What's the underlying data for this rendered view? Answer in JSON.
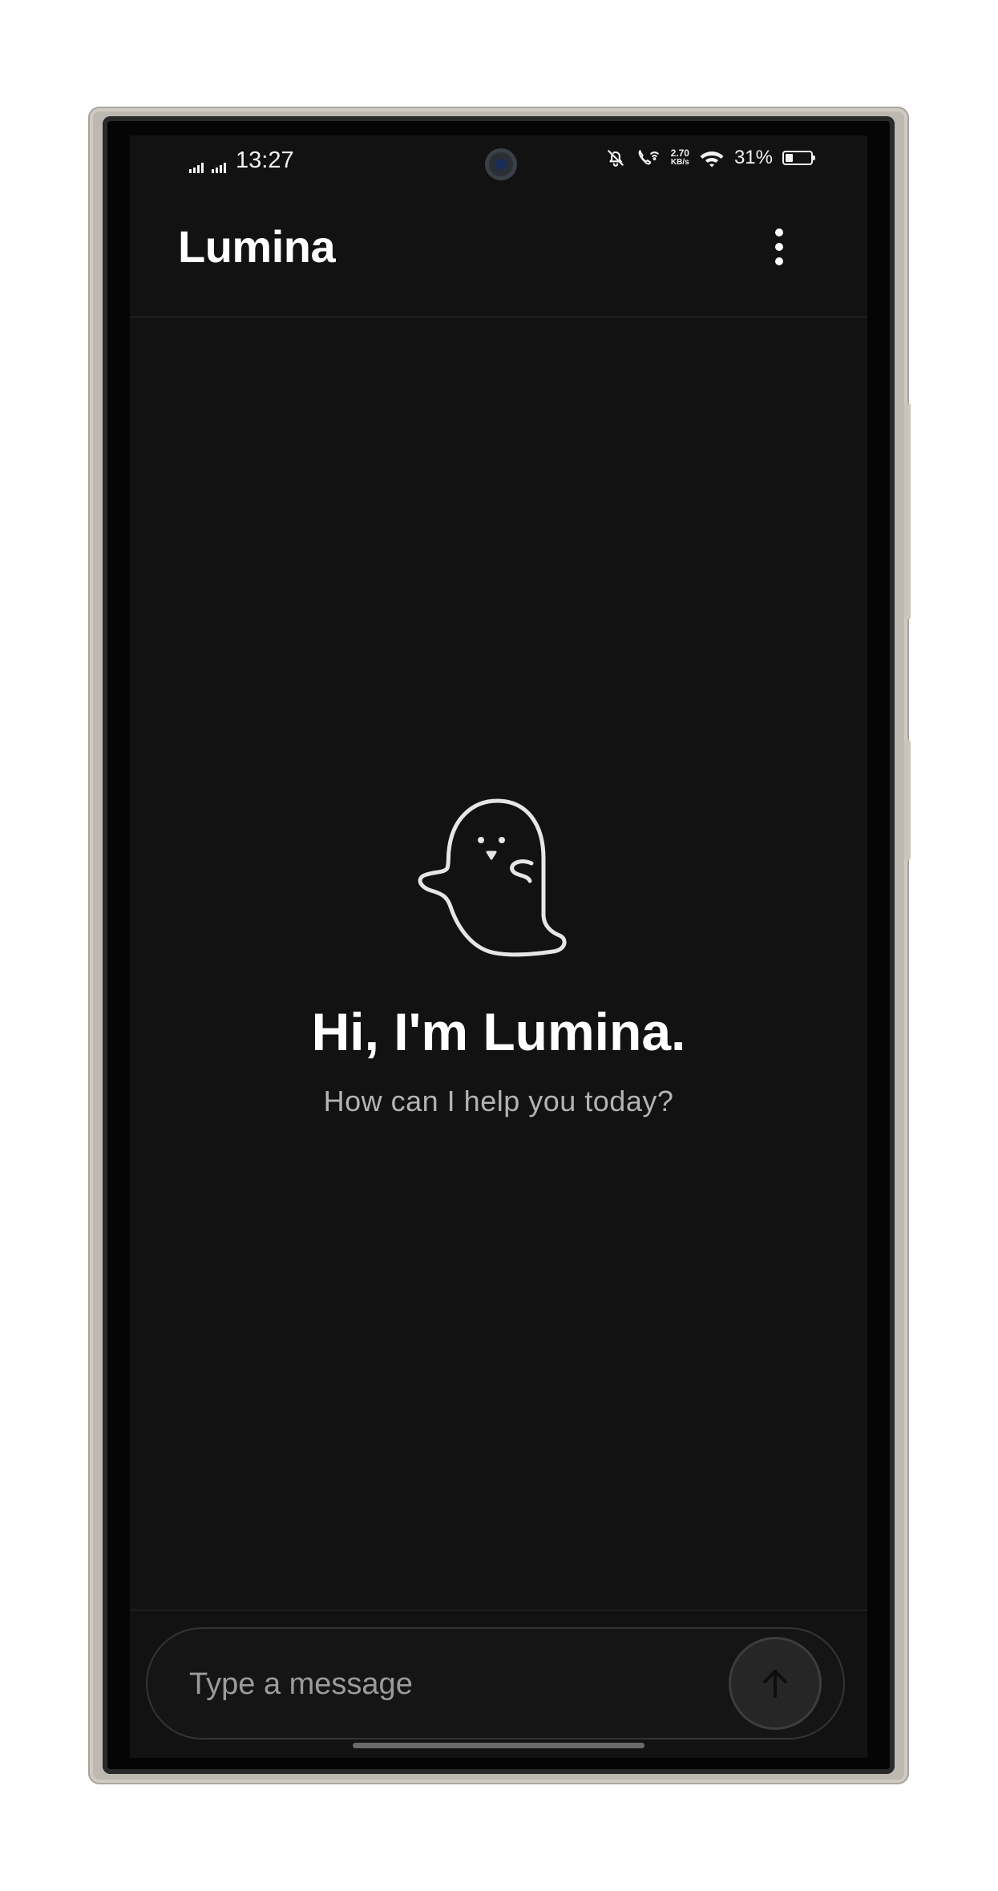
{
  "status_bar": {
    "time": "13:27",
    "network_speed_value": "2.70",
    "network_speed_unit": "KB/s",
    "battery_percent": "31%",
    "battery_level": 0.31
  },
  "app_bar": {
    "title": "Lumina",
    "menu_icon": "more-vert-icon"
  },
  "welcome": {
    "icon": "ghost-icon",
    "title": "Hi, I'm Lumina.",
    "subtitle": "How can I help you today?"
  },
  "composer": {
    "placeholder": "Type a message",
    "value": "",
    "send_icon": "arrow-up-icon"
  },
  "colors": {
    "background": "#121212",
    "text_primary": "#ffffff",
    "text_secondary": "#b3b3b3",
    "send_button": "#262626"
  }
}
